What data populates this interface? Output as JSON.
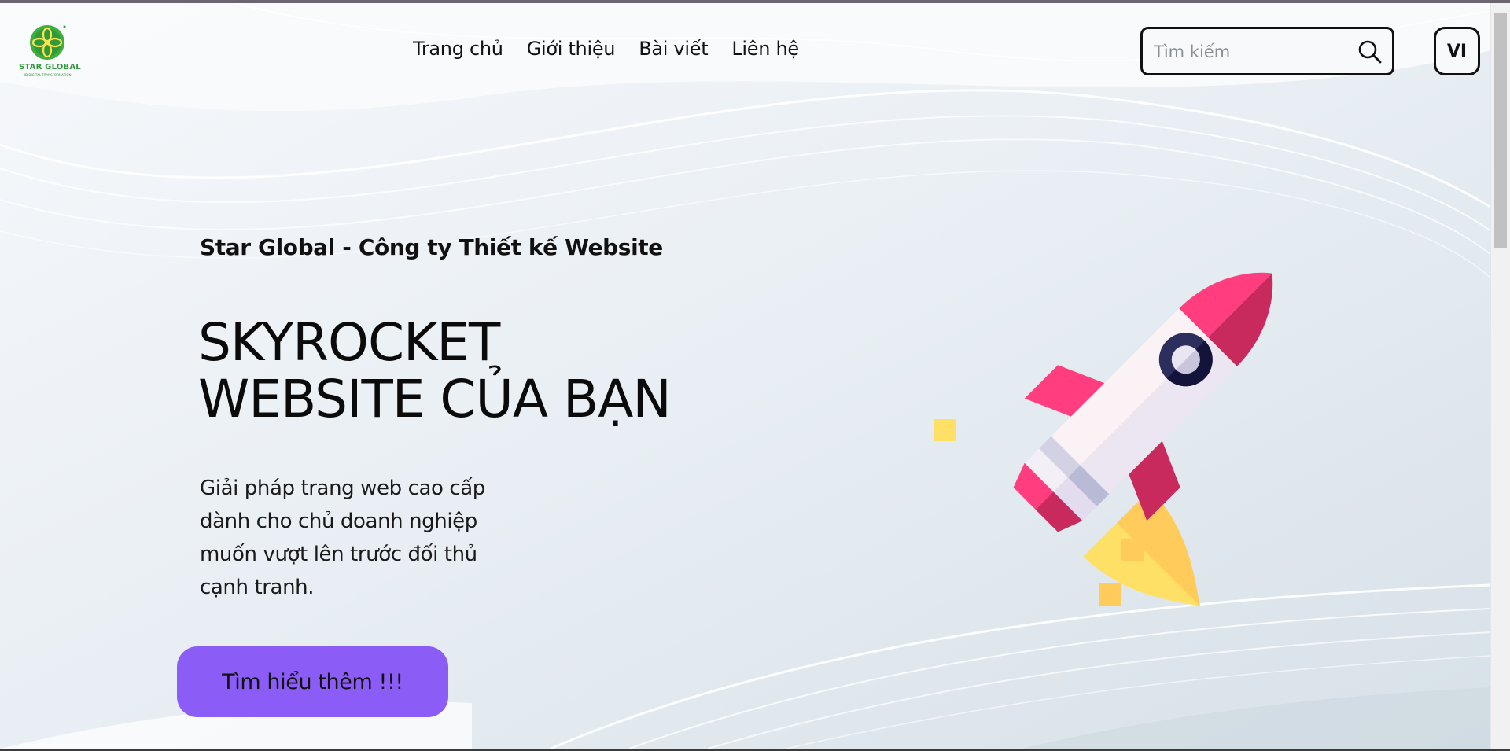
{
  "brand": {
    "logo_text": "STAR GLOBAL",
    "logo_tagline": "3D DIGITAL TRANSFORMATION"
  },
  "nav": {
    "items": [
      "Trang chủ",
      "Giới thiệu",
      "Bài viết",
      "Liên hệ"
    ]
  },
  "search": {
    "placeholder": "Tìm kiếm",
    "value": "",
    "icon": "search-icon"
  },
  "language": {
    "label": "VI"
  },
  "hero": {
    "subtitle": "Star Global - Công ty Thiết kế Website",
    "headline_line1": "SKYROCKET",
    "headline_line2": "WEBSITE CỦA BẠN",
    "description": "Giải pháp trang web cao cấp dành cho chủ doanh nghiệp muốn vượt lên trước đối thủ cạnh tranh.",
    "cta_label": "Tìm hiểu thêm !!!",
    "illustration": "rocket-illustration"
  },
  "colors": {
    "cta": "#8b5cf6",
    "brand_green": "#2e9a3a",
    "rocket_pink": "#ff3d7f",
    "rocket_dark_pink": "#c92a5e",
    "flame_yellow": "#ffe066"
  }
}
